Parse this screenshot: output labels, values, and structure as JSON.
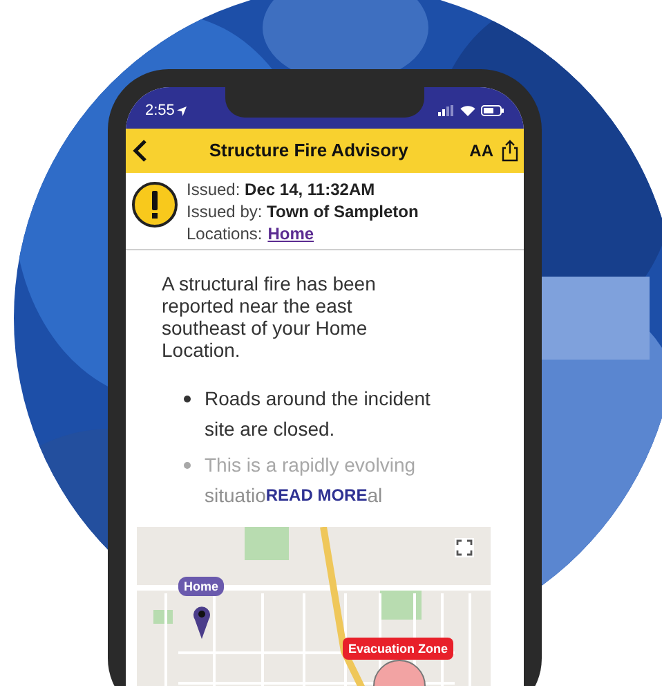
{
  "status_bar": {
    "time": "2:55"
  },
  "header": {
    "title": "Structure Fire Advisory",
    "text_size": "AA"
  },
  "info": {
    "issued_label": "Issued:",
    "issued": "Dec 14, 11:32AM",
    "issued_by_label": "Issued by:",
    "issued_by": "Town of Sampleton",
    "locations_label": "Locations:",
    "location_link": "Home"
  },
  "message": "A structural fire has been reported near the east southeast of your Home Location.",
  "bullets": [
    {
      "lines": [
        "Roads around the incident",
        "site are closed."
      ],
      "faded": false
    },
    {
      "lines": [
        "This is a rapidly evolving",
        "situatio"
      ],
      "tail": "al",
      "faded": true
    }
  ],
  "read_more": "READ MORE",
  "map": {
    "home_label": "Home",
    "zone_label": "Evacuation Zone"
  }
}
